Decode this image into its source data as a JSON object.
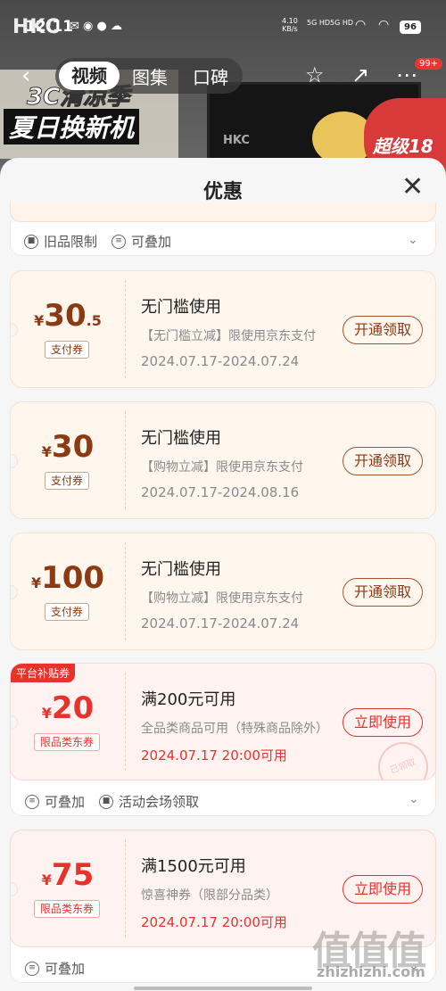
{
  "status": {
    "time": "12:11",
    "net_speed_value": "4.10",
    "net_speed_unit": "KB/s",
    "signal1": "5G HD",
    "signal2": "5G HD",
    "battery": "96",
    "hkc": "HKC"
  },
  "nav": {
    "tabs": [
      "视频",
      "图集",
      "口碑"
    ],
    "badge": "99+"
  },
  "background": {
    "banner_line1": "3C清凉季",
    "banner_line2": "夏日换新机",
    "monitor_brand": "HKC",
    "promo": "超级18"
  },
  "sheet": {
    "title": "优惠",
    "top_tags": [
      "旧品限制",
      "可叠加"
    ]
  },
  "coupons": [
    {
      "currency": "¥",
      "amount": "30",
      "decimal": ".5",
      "type": "支付券",
      "title": "无门槛使用",
      "desc": "【无门槛立减】限使用京东支付",
      "date": "2024.07.17-2024.07.24",
      "button": "开通领取"
    },
    {
      "currency": "¥",
      "amount": "30",
      "decimal": "",
      "type": "支付券",
      "title": "无门槛使用",
      "desc": "【购物立减】限使用京东支付",
      "date": "2024.07.17-2024.08.16",
      "button": "开通领取"
    },
    {
      "currency": "¥",
      "amount": "100",
      "decimal": "",
      "type": "支付券",
      "title": "无门槛使用",
      "desc": "【购物立减】限使用京东支付",
      "date": "2024.07.17-2024.07.24",
      "button": "开通领取"
    },
    {
      "corner": "平台补贴券",
      "currency": "¥",
      "amount": "20",
      "type": "限品类东券",
      "title": "满200元可用",
      "desc": "全品类商品可用（特殊商品除外）",
      "date": "2024.07.17 20:00可用",
      "button": "立即使用",
      "stamp": "已领取",
      "tags": [
        "可叠加",
        "活动会场领取"
      ]
    },
    {
      "currency": "¥",
      "amount": "75",
      "type": "限品类东券",
      "title": "满1500元可用",
      "desc": "惊喜神券（限部分品类）",
      "date": "2024.07.17 20:00可用",
      "button": "立即使用",
      "tags": [
        "可叠加"
      ]
    }
  ],
  "watermark": {
    "logo": "值值值",
    "site": "zhizhizhi.com"
  },
  "colors": {
    "accent_brown": "#8b3a12",
    "accent_red": "#e8322c",
    "coupon_bg": "#fff6ee"
  }
}
